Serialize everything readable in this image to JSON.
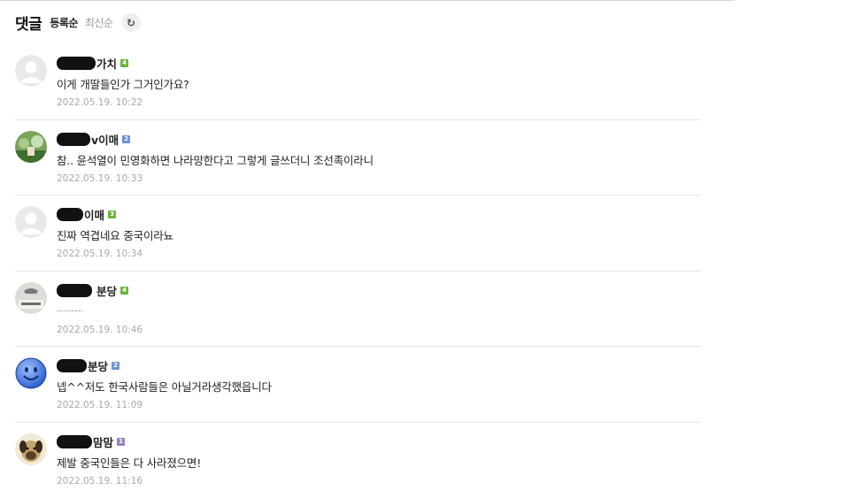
{
  "header": {
    "title": "댓글",
    "sort_registered": "등록순",
    "sort_latest": "최신순",
    "refresh_icon": "refresh-icon"
  },
  "comments": [
    {
      "nick": "가치",
      "level_badge": "4",
      "level_color": "#6cb33f",
      "text": "이게 개딸들인가 그거인가요?",
      "date": "2022.05.19. 10:22",
      "avatar": "default-avatar"
    },
    {
      "nick": "v이매",
      "level_badge": "2",
      "level_color": "#6b93d6",
      "text": "참.. 윤석열이 민영화하면 나라망한다고 그렇게 글쓰더니 조선족이라니",
      "date": "2022.05.19. 10:33",
      "avatar": "photo-avatar-green"
    },
    {
      "nick": "이매",
      "level_badge": "3",
      "level_color": "#6cb33f",
      "text": "진짜 역겹네요 중국이라뇨",
      "date": "2022.05.19. 10:34",
      "avatar": "default-avatar"
    },
    {
      "nick": "분당",
      "level_badge": "4",
      "level_color": "#6cb33f",
      "text": "...........",
      "date": "2022.05.19. 10:46",
      "avatar": "photo-avatar-gray"
    },
    {
      "nick": "분당",
      "level_badge": "2",
      "level_color": "#6b93d6",
      "text": "넵^^저도 한국사람들은 아닐거라생각했읍니다",
      "date": "2022.05.19. 11:09",
      "avatar": "smiley-avatar"
    },
    {
      "nick": "맘맘",
      "level_badge": "1",
      "level_color": "#9b7fc4",
      "text": "제발 중국인들은 다 사라졌으면!",
      "date": "2022.05.19. 11:16",
      "avatar": "dog-avatar"
    }
  ]
}
